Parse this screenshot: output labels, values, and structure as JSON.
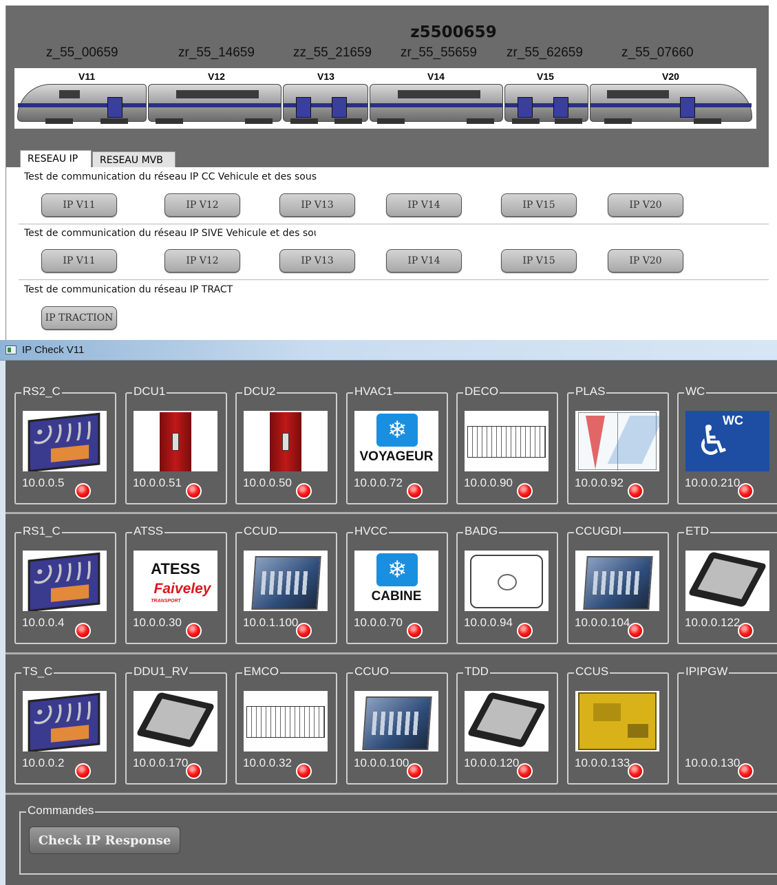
{
  "header": {
    "train_id": "z5500659",
    "car_codes": [
      "z_55_00659",
      "zr_55_14659",
      "zz_55_21659",
      "zr_55_55659",
      "zr_55_62659",
      "z_55_07660"
    ],
    "car_names": [
      "V11",
      "V12",
      "V13",
      "V14",
      "V15",
      "V20"
    ]
  },
  "tabs": [
    {
      "label": "RESEAU IP",
      "active": true
    },
    {
      "label": "RESEAU MVB",
      "active": false
    }
  ],
  "sections": [
    {
      "label": "Test de communication du réseau IP CC Vehicule et des sous",
      "buttons": [
        "IP V11",
        "IP V12",
        "IP V13",
        "IP V14",
        "IP V15",
        "IP V20"
      ]
    },
    {
      "label": "Test de communication du réseau IP SIVE Vehicule et des sou",
      "buttons": [
        "IP V11",
        "IP V12",
        "IP V13",
        "IP V14",
        "IP V15",
        "IP V20"
      ]
    },
    {
      "label": "Test de communication du réseau IP TRACT",
      "buttons": [
        "IP TRACTION"
      ]
    }
  ],
  "ipcheck": {
    "title": "IP Check V11",
    "led_color": "#ff1a1a",
    "rows": [
      [
        {
          "name": "RS2_C",
          "ip": "10.0.0.5",
          "icon": "switch-icon"
        },
        {
          "name": "DCU1",
          "ip": "10.0.0.51",
          "icon": "door-unit-icon"
        },
        {
          "name": "DCU2",
          "ip": "10.0.0.50",
          "icon": "door-unit-icon"
        },
        {
          "name": "HVAC1",
          "ip": "10.0.0.72",
          "icon": "snowflake-icon",
          "caption": "VOYAGEUR"
        },
        {
          "name": "DECO",
          "ip": "10.0.0.90",
          "icon": "rack-icon"
        },
        {
          "name": "PLAS",
          "ip": "10.0.0.92",
          "icon": "laser-icon"
        },
        {
          "name": "WC",
          "ip": "10.0.0.210",
          "icon": "wheelchair-icon",
          "caption": "WC"
        }
      ],
      [
        {
          "name": "RS1_C",
          "ip": "10.0.0.4",
          "icon": "switch-icon"
        },
        {
          "name": "ATSS",
          "ip": "10.0.0.30",
          "icon": "logo-icon",
          "caption": "ATESS",
          "caption2": "Faiveley",
          "caption3": "TRANSPORT"
        },
        {
          "name": "CCUD",
          "ip": "10.0.1.100",
          "icon": "controller-icon"
        },
        {
          "name": "HVCC",
          "ip": "10.0.0.70",
          "icon": "snowflake-icon",
          "caption": "CABINE"
        },
        {
          "name": "BADG",
          "ip": "10.0.0.94",
          "icon": "badge-reader-icon"
        },
        {
          "name": "CCUGDI",
          "ip": "10.0.0.104",
          "icon": "controller-icon"
        },
        {
          "name": "ETD",
          "ip": "10.0.0.122",
          "icon": "display-icon"
        }
      ],
      [
        {
          "name": "TS_C",
          "ip": "10.0.0.2",
          "icon": "switch-icon"
        },
        {
          "name": "DDU1_RV",
          "ip": "10.0.0.170",
          "icon": "display-icon"
        },
        {
          "name": "EMCO",
          "ip": "10.0.0.32",
          "icon": "rack-icon"
        },
        {
          "name": "CCUO",
          "ip": "10.0.0.100",
          "icon": "controller-icon"
        },
        {
          "name": "TDD",
          "ip": "10.0.0.120",
          "icon": "display-icon"
        },
        {
          "name": "CCUS",
          "ip": "10.0.0.133",
          "icon": "circuit-board-icon"
        },
        {
          "name": "IPIPGW",
          "ip": "10.0.0.130",
          "icon": ""
        }
      ]
    ],
    "commands": {
      "label": "Commandes",
      "check_button": "Check IP Response"
    }
  }
}
